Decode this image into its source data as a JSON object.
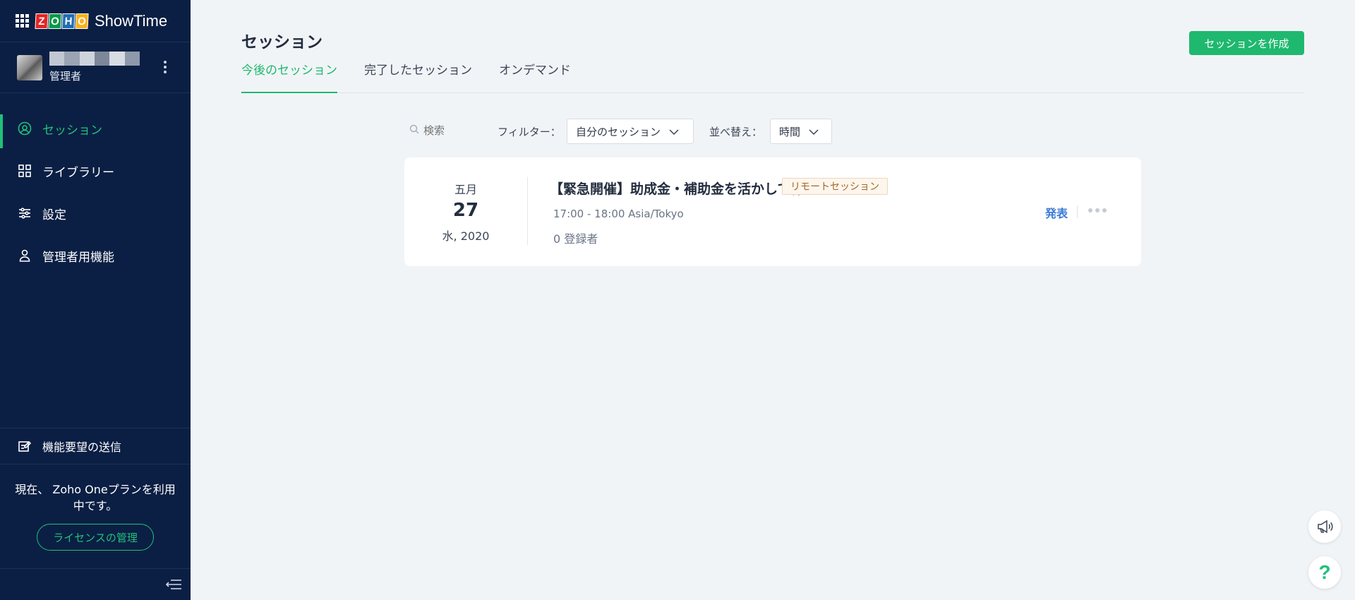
{
  "brand": {
    "name": "ShowTime",
    "logo_letters": [
      "Z",
      "O",
      "H",
      "O"
    ],
    "logo_colors": [
      "#e42527",
      "#089949",
      "#226db4",
      "#f9b21d"
    ]
  },
  "profile": {
    "role": "管理者",
    "name_blur_colors": [
      "#c2c8d2",
      "#9aa4b3",
      "#cfd4dc",
      "#7c879a",
      "#d8dce3",
      "#8e99ab"
    ]
  },
  "nav": {
    "items": [
      {
        "label": "セッション",
        "icon": "sessions-icon",
        "active": true
      },
      {
        "label": "ライブラリー",
        "icon": "library-grid-icon",
        "active": false
      },
      {
        "label": "設定",
        "icon": "settings-sliders-icon",
        "active": false
      },
      {
        "label": "管理者用機能",
        "icon": "admin-user-icon",
        "active": false
      }
    ]
  },
  "feedback": {
    "label": "機能要望の送信"
  },
  "plan": {
    "text_line1": "現在、 Zoho Oneプランを利用",
    "text_line2": "中です。",
    "license_button": "ライセンスの管理"
  },
  "header": {
    "title": "セッション",
    "create_button": "セッションを作成"
  },
  "tabs": [
    {
      "label": "今後のセッション",
      "active": true
    },
    {
      "label": "完了したセッション",
      "active": false
    },
    {
      "label": "オンデマンド",
      "active": false
    }
  ],
  "toolbar": {
    "search_placeholder": "検索",
    "filter_label": "フィルター：",
    "filter_value": "自分のセッション",
    "sort_label": "並べ替え：",
    "sort_value": "時間"
  },
  "session": {
    "month": "五月",
    "day": "27",
    "weekday_year": "水, 2020",
    "title": "【緊急開催】助成金・補助金を活かして作り上げ...",
    "badge": "リモートセッション",
    "time": "17:00 - 18:00 Asia/Tokyo",
    "registrants": "0 登録者",
    "present_label": "発表"
  },
  "colors": {
    "sidebar_bg": "#0b1f44",
    "accent_green": "#1fb86f",
    "link_blue": "#3a7bd5",
    "page_bg": "#f1f4f7"
  },
  "float_buttons": {
    "help_label": "?"
  }
}
